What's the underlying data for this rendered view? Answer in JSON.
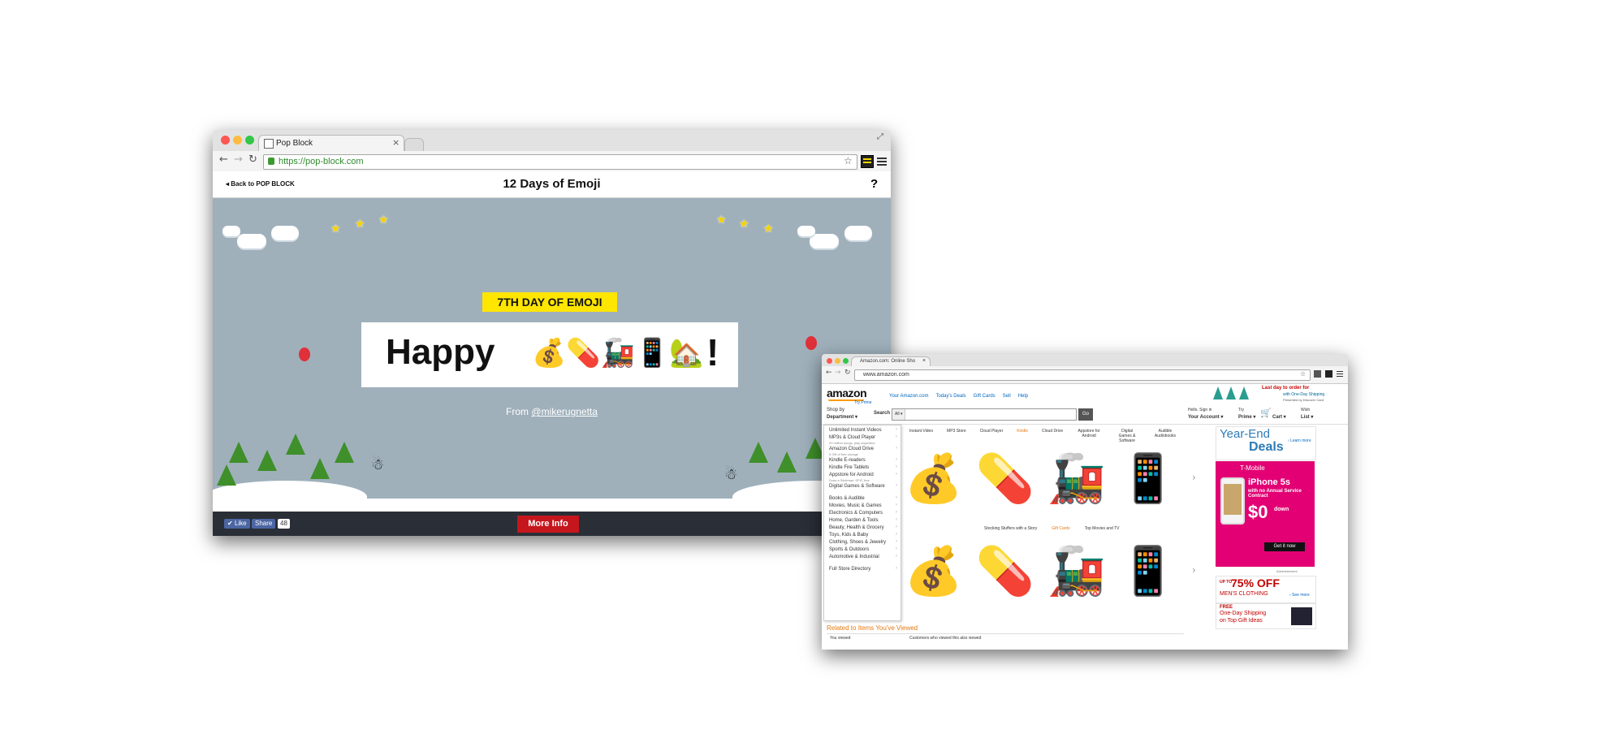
{
  "left_window": {
    "tab_title": "Pop Block",
    "url": "https://pop-block.com",
    "back_link": "Back to POP BLOCK",
    "page_title": "12 Days of Emoji",
    "help": "?",
    "day_badge": "7TH DAY OF EMOJI",
    "message_word": "Happy",
    "message_emoji": "💰💊🚂📱🏡",
    "message_end": "!",
    "from_label": "From",
    "from_handle": "@mikerugnetta",
    "like_label": "Like",
    "share_label": "Share",
    "share_count": "48",
    "more_info": "More Info",
    "colors": {
      "scene": "#9fb0bb",
      "badge": "#ffe600",
      "bottom_bar": "#2a2e36",
      "more_info": "#c6161d"
    }
  },
  "right_window": {
    "tab_title": "Amazon.com: Online Sho",
    "url": "www.amazon.com",
    "logo": "amazon",
    "logo_sub": "Try Prime",
    "top_nav": [
      "Your Amazon.com",
      "Today's Deals",
      "Gift Cards",
      "Sell",
      "Help"
    ],
    "promo_line1": "Last day to order for",
    "promo_line2": "with One-Day Shipping",
    "promo_line3": "Presented by Discover Card",
    "shop_by_1": "Shop by",
    "shop_by_2": "Department",
    "search_label": "Search",
    "search_scope": "All",
    "go_label": "Go",
    "account_1": "Hello. Sign in",
    "account_2": "Your Account",
    "prime_1": "Try",
    "prime_2": "Prime",
    "cart": "Cart",
    "wish_1": "Wish",
    "wish_2": "List",
    "sidebar": [
      {
        "label": "Unlimited Instant Videos",
        "sub": ""
      },
      {
        "label": "MP3s & Cloud Player",
        "sub": "20 million songs, play anywhere"
      },
      {
        "label": "Amazon Cloud Drive",
        "sub": "5 GB of free storage"
      },
      {
        "label": "Kindle E-readers",
        "sub": ""
      },
      {
        "label": "Kindle Fire Tablets",
        "sub": ""
      },
      {
        "label": "Appstore for Android",
        "sub": "Draw a Stickman: EPIC free"
      },
      {
        "label": "Digital Games & Software",
        "sub": ""
      },
      {
        "label": "Books & Audible",
        "sub": ""
      },
      {
        "label": "Movies, Music & Games",
        "sub": ""
      },
      {
        "label": "Electronics & Computers",
        "sub": ""
      },
      {
        "label": "Home, Garden & Tools",
        "sub": ""
      },
      {
        "label": "Beauty, Health & Grocery",
        "sub": ""
      },
      {
        "label": "Toys, Kids & Baby",
        "sub": ""
      },
      {
        "label": "Clothing, Shoes & Jewelry",
        "sub": ""
      },
      {
        "label": "Sports & Outdoors",
        "sub": ""
      },
      {
        "label": "Automotive & Industrial",
        "sub": ""
      },
      {
        "label": "Full Store Directory",
        "sub": ""
      }
    ],
    "subnav": [
      "Instant Video",
      "MP3 Store",
      "Cloud Player",
      "Kindle",
      "Cloud Drive",
      "Appstore for Android",
      "Digital Games & Software",
      "Audible Audiobooks"
    ],
    "emoji_row": [
      "💰",
      "💊",
      "🚂",
      "📱"
    ],
    "row_caption": [
      "Stocking Stuffers with a Story",
      "Gift Cards",
      "Top Movies and TV"
    ],
    "related_heading": "Related to Items You've Viewed",
    "related_col1": "You viewed",
    "related_col2": "Customers who viewed this also viewed",
    "year_end_1": "Year-End",
    "year_end_2": "Deals",
    "learn_more": "› Learn more",
    "tmobile": "T-Mobile",
    "iphone": "iPhone 5s",
    "iphone_sub": "with no Annual Service Contract",
    "price": "$0",
    "price_sub": "down",
    "get_now": "Get it now",
    "advertisement": "Advertisement",
    "sale_pct": "75% OFF",
    "sale_upto": "UP TO",
    "sale_sub": "MEN'S CLOTHING",
    "sale_see": "› See more",
    "ship_1": "FREE",
    "ship_2": "One-Day Shipping",
    "ship_3": "on Top Gift Ideas",
    "colors": {
      "t_mobile": "#e20074",
      "sale": "#c40000",
      "prime": "#0066c0",
      "orange": "#e47911"
    }
  }
}
